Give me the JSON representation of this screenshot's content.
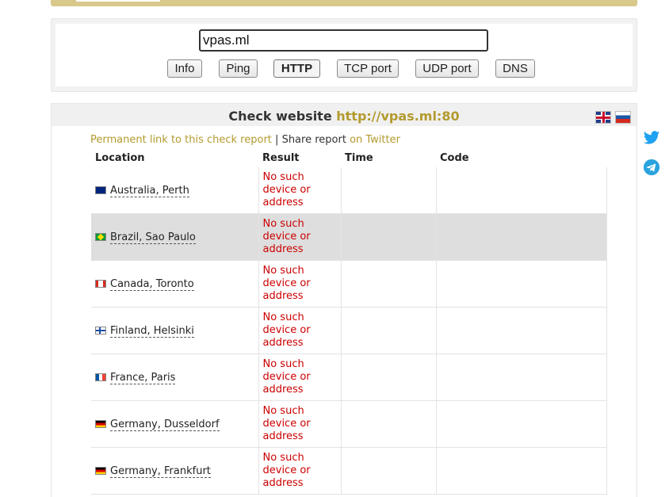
{
  "host_input": {
    "value": "vpas.ml"
  },
  "tabs": [
    {
      "label": "Info"
    },
    {
      "label": "Ping"
    },
    {
      "label": "HTTP",
      "active": true
    },
    {
      "label": "TCP port"
    },
    {
      "label": "UDP port"
    },
    {
      "label": "DNS"
    }
  ],
  "result": {
    "title_prefix": "Check website",
    "title_url": "http://vpas.ml:80",
    "permanent_link": "Permanent link to this check report",
    "separator": "|",
    "share_label": "Share report",
    "share_twitter": "on Twitter"
  },
  "table": {
    "headers": {
      "location": "Location",
      "result": "Result",
      "time": "Time",
      "code": "Code"
    },
    "rows": [
      {
        "flag": "au-flag",
        "location": "Australia, Perth",
        "result": "No such device or address",
        "time": "",
        "code": ""
      },
      {
        "flag": "br-flag",
        "location": "Brazil, Sao Paulo",
        "result": "No such device or address",
        "time": "",
        "code": ""
      },
      {
        "flag": "ca-flag",
        "location": "Canada, Toronto",
        "result": "No such device or address",
        "time": "",
        "code": ""
      },
      {
        "flag": "fi-flag",
        "location": "Finland, Helsinki",
        "result": "No such device or address",
        "time": "",
        "code": ""
      },
      {
        "flag": "fr-flag",
        "location": "France, Paris",
        "result": "No such device or address",
        "time": "",
        "code": ""
      },
      {
        "flag": "de-flag",
        "location": "Germany, Dusseldorf",
        "result": "No such device or address",
        "time": "",
        "code": ""
      },
      {
        "flag": "de-flag",
        "location": "Germany, Frankfurt",
        "result": "No such device or address",
        "time": "",
        "code": ""
      }
    ]
  },
  "colors": {
    "accent_gold": "#b39a2e",
    "error_red": "#cc0000",
    "twitter_blue": "#1da1f2",
    "telegram_blue": "#2aa3df"
  },
  "icons": {
    "language_en": "gb-flag-icon",
    "language_ru": "ru-flag-icon",
    "share_twitter": "twitter-icon",
    "share_telegram": "telegram-icon"
  }
}
